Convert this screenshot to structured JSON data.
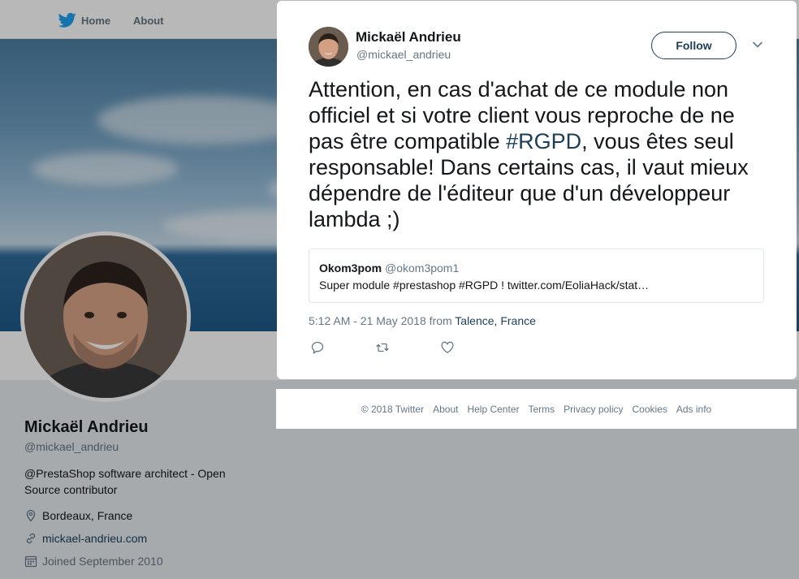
{
  "nav": {
    "home_label": "Home",
    "about_label": "About"
  },
  "profile": {
    "name": "Mickaël Andrieu",
    "handle": "@mickael_andrieu",
    "bio": "@PrestaShop software architect - Open Source contributor",
    "location": "Bordeaux, France",
    "website": "mickael-andrieu.com",
    "joined": "Joined September 2010"
  },
  "tweet": {
    "author_name": "Mickaël Andrieu",
    "author_handle": "@mickael_andrieu",
    "follow_label": "Follow",
    "text_before": "Attention, en cas d'achat de ce module non officiel et si votre client vous reproche de ne pas être compatible ",
    "hashtag": "#RGPD",
    "text_after": ", vous êtes seul responsable! Dans certains cas, il vaut mieux dépendre de l'éditeur que d'un développeur lambda ;)",
    "quoted": {
      "name": "Okom3pom",
      "handle": "@okom3pom1",
      "text": "Super module #prestashop #RGPD ! twitter.com/EoliaHack/stat…"
    },
    "timestamp": "5:12 AM - 21 May 2018 from ",
    "location": "Talence, France",
    "actions": [
      "reply-icon",
      "retweet-icon",
      "like-icon"
    ]
  },
  "footer": {
    "links": [
      "© 2018 Twitter",
      "About",
      "Help Center",
      "Terms",
      "Privacy policy",
      "Cookies",
      "Ads info"
    ]
  },
  "colors": {
    "link": "#1c3e57",
    "muted": "#657786",
    "text": "#14171a",
    "twitter_blue": "#1da1f2"
  }
}
